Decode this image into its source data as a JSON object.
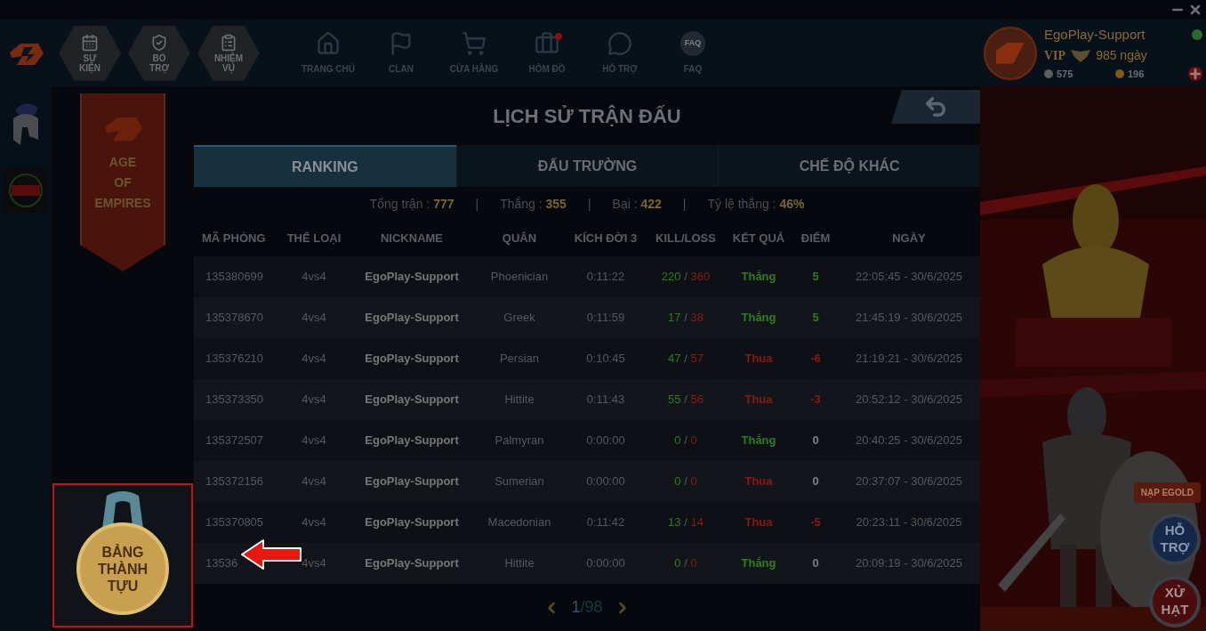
{
  "nav": {
    "hex_buttons": [
      {
        "kind": "event",
        "label": "SỰ KIỆN"
      },
      {
        "kind": "support",
        "label": "BỔ TRỢ"
      },
      {
        "kind": "mission",
        "label": "NHIỆM VỤ"
      }
    ],
    "items": [
      {
        "kind": "home",
        "label": "TRANG CHỦ",
        "notification": false
      },
      {
        "kind": "clan",
        "label": "CLAN",
        "notification": false
      },
      {
        "kind": "shop",
        "label": "CỬA HÀNG",
        "notification": false
      },
      {
        "kind": "inventory",
        "label": "HÒM ĐỒ",
        "notification": true
      },
      {
        "kind": "chat",
        "label": "HỖ TRỢ",
        "notification": false
      },
      {
        "kind": "faq",
        "label": "FAQ",
        "icon_text": "FAQ",
        "notification": false
      }
    ]
  },
  "profile": {
    "name": "EgoPlay-Support",
    "vip": "VIP",
    "days": "985 ngày",
    "silver": "575",
    "gold": "196"
  },
  "banner": {
    "lines": [
      "AGE",
      "OF",
      "EMPIRES"
    ]
  },
  "title": "LỊCH SỬ TRẬN ĐẤU",
  "tabs": [
    {
      "label": "RANKING",
      "selected": true
    },
    {
      "label": "ĐẤU TRƯỜNG",
      "selected": false
    },
    {
      "label": "CHẾ ĐỘ KHÁC",
      "selected": false
    }
  ],
  "stats": [
    {
      "label": "Tổng trận :",
      "value": "777"
    },
    {
      "label": "Thắng :",
      "value": "355"
    },
    {
      "label": "Bại :",
      "value": "422"
    },
    {
      "label": "Tỷ lệ thắng :",
      "value": "46%"
    }
  ],
  "stats_separator": "|",
  "kill_loss_separator": "/",
  "columns": [
    "MÃ PHÒNG",
    "THỂ LOẠI",
    "NICKNAME",
    "QUÂN",
    "KÍCH ĐỜI 3",
    "KILL/LOSS",
    "KẾT QUẢ",
    "ĐIỂM",
    "NGÀY"
  ],
  "rows": [
    {
      "room": "135380699",
      "type": "4vs4",
      "nickname": "EgoPlay-Support",
      "faction": "Phoenician",
      "time": "0:11:22",
      "kills": "220",
      "losses": "360",
      "result": "Thắng",
      "won": true,
      "points": "5",
      "scored": true,
      "date": "22:05:45 - 30/6/2025"
    },
    {
      "room": "135378670",
      "type": "4vs4",
      "nickname": "EgoPlay-Support",
      "faction": "Greek",
      "time": "0:11:59",
      "kills": "17",
      "losses": "38",
      "result": "Thắng",
      "won": true,
      "points": "5",
      "scored": true,
      "date": "21:45:19 - 30/6/2025"
    },
    {
      "room": "135376210",
      "type": "4vs4",
      "nickname": "EgoPlay-Support",
      "faction": "Persian",
      "time": "0:10:45",
      "kills": "47",
      "losses": "57",
      "result": "Thua",
      "won": false,
      "points": "-6",
      "scored": true,
      "date": "21:19:21 - 30/6/2025"
    },
    {
      "room": "135373350",
      "type": "4vs4",
      "nickname": "EgoPlay-Support",
      "faction": "Hittite",
      "time": "0:11:43",
      "kills": "55",
      "losses": "56",
      "result": "Thua",
      "won": false,
      "points": "-3",
      "scored": true,
      "date": "20:52:12 - 30/6/2025"
    },
    {
      "room": "135372507",
      "type": "4vs4",
      "nickname": "EgoPlay-Support",
      "faction": "Palmyran",
      "time": "0:00:00",
      "kills": "0",
      "losses": "0",
      "result": "Thắng",
      "won": true,
      "points": "0",
      "scored": false,
      "date": "20:40:25 - 30/6/2025"
    },
    {
      "room": "135372156",
      "type": "4vs4",
      "nickname": "EgoPlay-Support",
      "faction": "Sumerian",
      "time": "0:00:00",
      "kills": "0",
      "losses": "0",
      "result": "Thua",
      "won": false,
      "points": "0",
      "scored": false,
      "date": "20:37:07 - 30/6/2025"
    },
    {
      "room": "135370805",
      "type": "4vs4",
      "nickname": "EgoPlay-Support",
      "faction": "Macedonian",
      "time": "0:11:42",
      "kills": "13",
      "losses": "14",
      "result": "Thua",
      "won": false,
      "points": "-5",
      "scored": true,
      "date": "20:23:11 - 30/6/2025"
    },
    {
      "room": "13536",
      "type": "4vs4",
      "nickname": "EgoPlay-Support",
      "faction": "Hittite",
      "time": "0:00:00",
      "kills": "0",
      "losses": "0",
      "result": "Thắng",
      "won": true,
      "points": "0",
      "scored": false,
      "date": "20:09:19 - 30/6/2025"
    }
  ],
  "pagination": {
    "current": "1",
    "total": "/98"
  },
  "achievement": {
    "label": "BẢNG THÀNH TỰU"
  },
  "ad": {
    "kind": "picture",
    "buttons": [
      {
        "kind": "topup",
        "label": "NẠP EGOLD"
      },
      {
        "kind": "support",
        "label": "HỖ TRỢ"
      },
      {
        "kind": "penalty",
        "label": "XỬ HẠT"
      }
    ]
  }
}
